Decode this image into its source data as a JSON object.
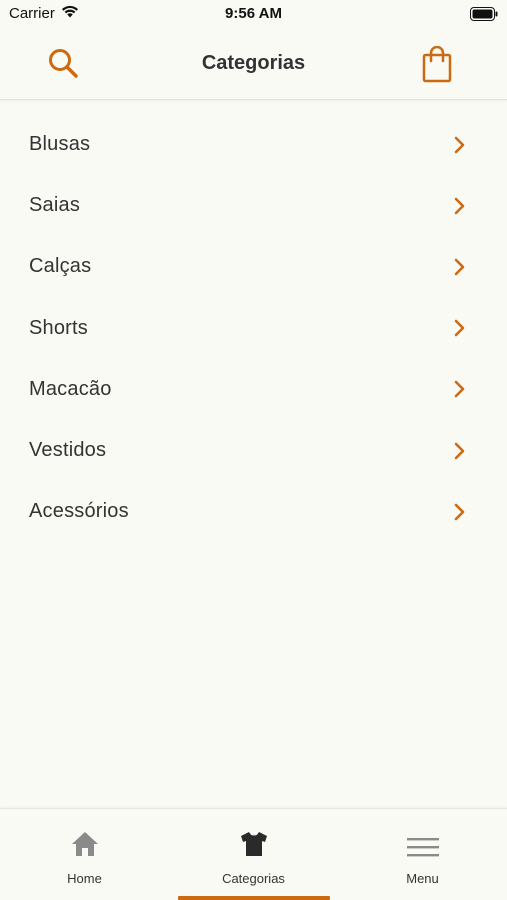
{
  "status_bar": {
    "carrier": "Carrier",
    "time": "9:56 AM"
  },
  "header": {
    "title": "Categorias",
    "search_icon": "search-icon",
    "bag_icon": "shopping-bag-icon"
  },
  "categories": [
    {
      "label": "Blusas"
    },
    {
      "label": "Saias"
    },
    {
      "label": "Calças"
    },
    {
      "label": "Shorts"
    },
    {
      "label": "Macacão"
    },
    {
      "label": "Vestidos"
    },
    {
      "label": "Acessórios"
    }
  ],
  "tab_bar": {
    "tabs": [
      {
        "label": "Home",
        "icon": "home-icon",
        "active": false
      },
      {
        "label": "Categorias",
        "icon": "tshirt-icon",
        "active": true
      },
      {
        "label": "Menu",
        "icon": "hamburger-menu-icon",
        "active": false
      }
    ]
  },
  "colors": {
    "accent": "#cc6a12",
    "background": "#fafaf5",
    "text": "#333333",
    "tab_icon_inactive": "#8a8a8a",
    "tab_icon_active": "#2a2a2a"
  }
}
